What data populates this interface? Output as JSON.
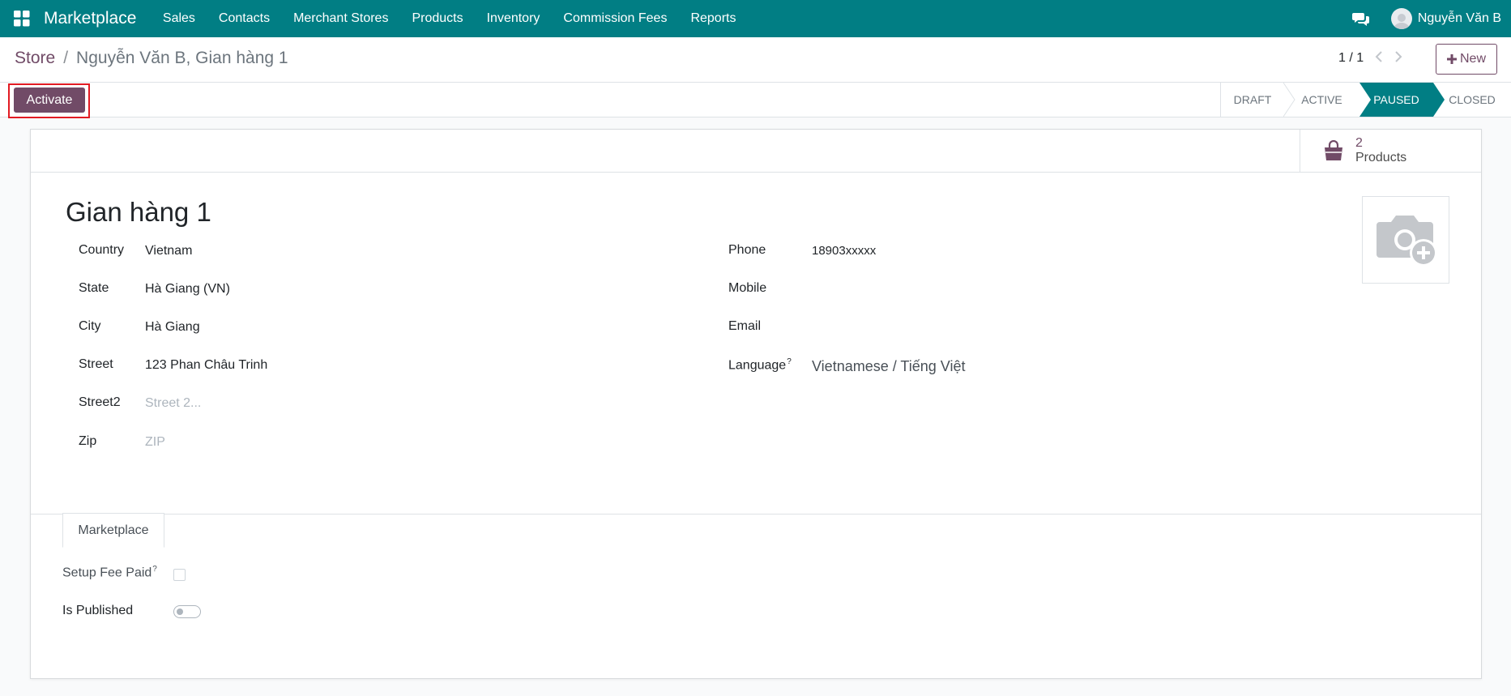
{
  "navbar": {
    "brand": "Marketplace",
    "menu": [
      "Sales",
      "Contacts",
      "Merchant Stores",
      "Products",
      "Inventory",
      "Commission Fees",
      "Reports"
    ],
    "user_name": "Nguyễn Văn B",
    "bg_color": "#017e84"
  },
  "control": {
    "breadcrumb_root": "Store",
    "breadcrumb_separator": "/",
    "breadcrumb_current": "Nguyễn Văn B, Gian hàng 1",
    "pager": "1 / 1",
    "new_label": "New",
    "activate_label": "Activate",
    "stages": [
      "DRAFT",
      "ACTIVE",
      "PAUSED",
      "CLOSED"
    ],
    "current_stage": "PAUSED",
    "accent_color": "#714b67"
  },
  "smart_button": {
    "value": "2",
    "label": "Products"
  },
  "record": {
    "title": "Gian hàng 1",
    "left_fields": [
      {
        "label": "Country",
        "value": "Vietnam",
        "placeholder": ""
      },
      {
        "label": "State",
        "value": "Hà Giang (VN)",
        "placeholder": ""
      },
      {
        "label": "City",
        "value": "Hà Giang",
        "placeholder": ""
      },
      {
        "label": "Street",
        "value": "123 Phan Châu Trinh",
        "placeholder": ""
      },
      {
        "label": "Street2",
        "value": "",
        "placeholder": "Street 2..."
      },
      {
        "label": "Zip",
        "value": "",
        "placeholder": "ZIP"
      }
    ],
    "right_fields": [
      {
        "label": "Phone",
        "value": "18903xxxxx"
      },
      {
        "label": "Mobile",
        "value": ""
      },
      {
        "label": "Email",
        "value": ""
      },
      {
        "label": "Language",
        "value": "Vietnamese / Tiếng Việt",
        "help": "?"
      }
    ]
  },
  "tabs": {
    "marketplace": "Marketplace",
    "setup_fee_label": "Setup Fee Paid",
    "setup_fee_help": "?",
    "setup_fee_checked": false,
    "is_published_label": "Is Published",
    "is_published_on": false
  }
}
